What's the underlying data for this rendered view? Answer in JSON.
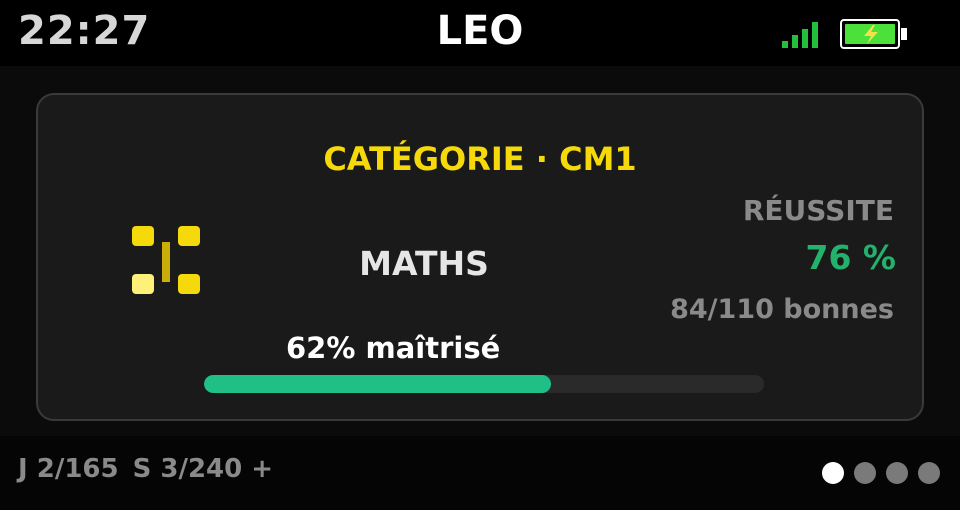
{
  "status_bar": {
    "time": "22:27",
    "title": "LEO",
    "signal_icon": "signal-bars-icon",
    "battery_icon": "battery-charging-icon",
    "colors": {
      "signal": "#22c03c",
      "battery": "#4be03a"
    }
  },
  "card": {
    "category": "CATÉGORIE · CM1",
    "subject_icon": "category-grid-icon",
    "subject": "MATHS",
    "mastery": {
      "label": "62% maîtrisé",
      "fraction": 0.62
    },
    "stats": {
      "label": "RÉUSSITE",
      "value": "76 %",
      "detail": "84/110 bonnes"
    },
    "colors": {
      "accent": "#f5d90a",
      "success": "#22b26c",
      "progress": "#1fbf85"
    }
  },
  "footer": {
    "counter_j": "J 2/165",
    "counter_s": "S 3/240 +",
    "pages": {
      "total": 4,
      "active": 1
    }
  }
}
